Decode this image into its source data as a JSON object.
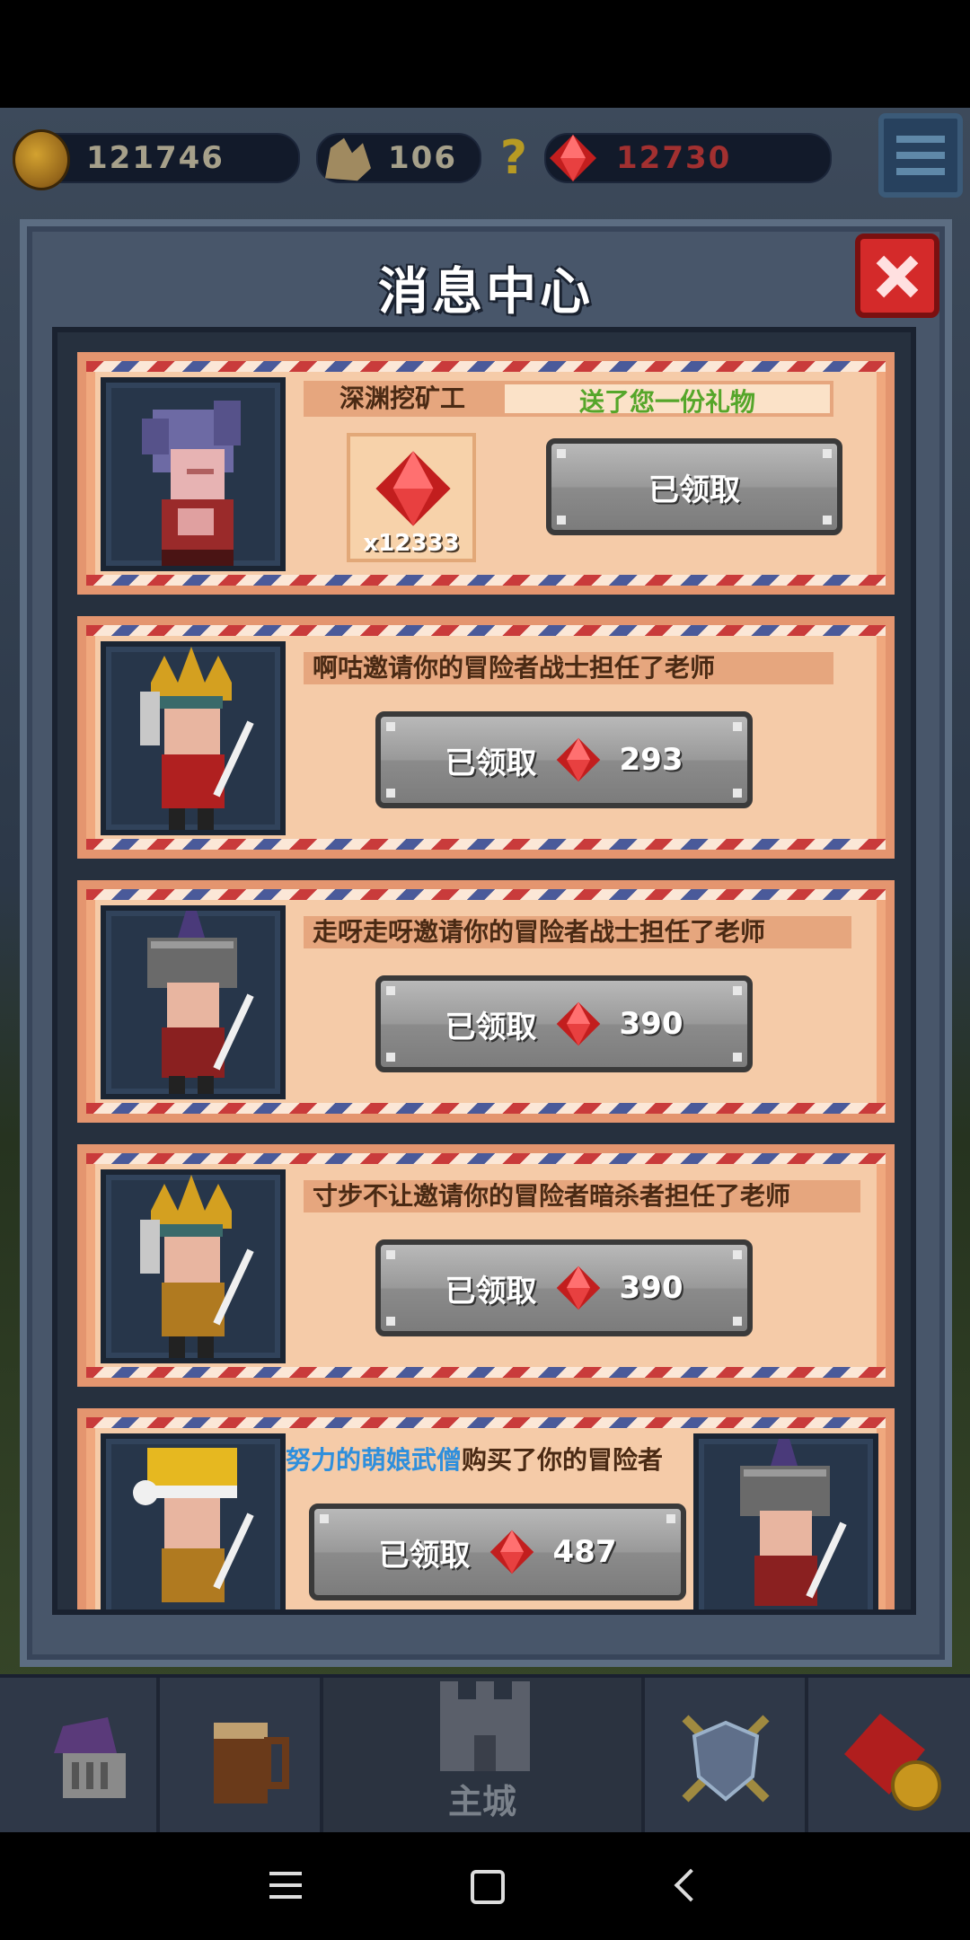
{
  "resources": {
    "gold": "121746",
    "ore": "106",
    "help": "?",
    "gems": "12730"
  },
  "panel": {
    "title": "消息中心"
  },
  "messages": [
    {
      "type": "gift",
      "sender": "深渊挖矿工",
      "text": "送了您一份礼物",
      "item_qty": "x12333",
      "button_label": "已领取"
    },
    {
      "type": "invite",
      "text": "啊咕邀请你的冒险者战士担任了老师",
      "button_label": "已领取",
      "reward": "293"
    },
    {
      "type": "invite",
      "text": "走呀走呀邀请你的冒险者战士担任了老师",
      "button_label": "已领取",
      "reward": "390"
    },
    {
      "type": "invite",
      "text": "寸步不让邀请你的冒险者暗杀者担任了老师",
      "button_label": "已领取",
      "reward": "390"
    },
    {
      "type": "purchase",
      "buyer": "努力的萌娘武僧",
      "text": "购买了你的冒险者",
      "button_label": "已领取",
      "reward": "487"
    }
  ],
  "bottom_nav": {
    "main_city": "主城"
  },
  "colors": {
    "gem": "#e02a2a",
    "buyer_name": "#2f8fdc",
    "gift_text": "#55a62a"
  }
}
